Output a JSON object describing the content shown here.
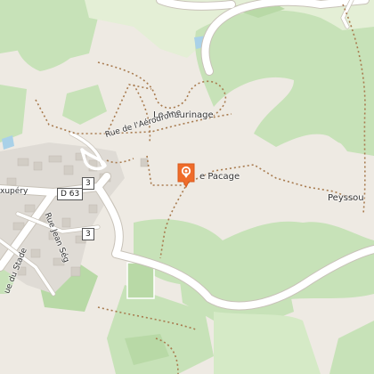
{
  "map": {
    "marker": {
      "icon": "map-pin-icon",
      "color": "#ef6c2a"
    },
    "places": {
      "maurinage": "Le Maurinage",
      "pacage": "e Pacage",
      "peyssou": "Peyssou",
      "exupery": "xupéry"
    },
    "streets": {
      "aerodrome": "Rue de l'Aérodrome",
      "jean_seg": "Rue Jean Ség",
      "stade": "ue du Stade"
    },
    "road_refs": {
      "d63": "D 63",
      "r3a": "3",
      "r3b": "3"
    },
    "colors": {
      "background": "#eeeae3",
      "forest": "#c7e2b8",
      "forest_dark": "#b8d9a6",
      "built": "#dfdbd5",
      "water": "#a9d1e8",
      "path": "#a87b4f",
      "marker": "#ef6c2a"
    }
  }
}
